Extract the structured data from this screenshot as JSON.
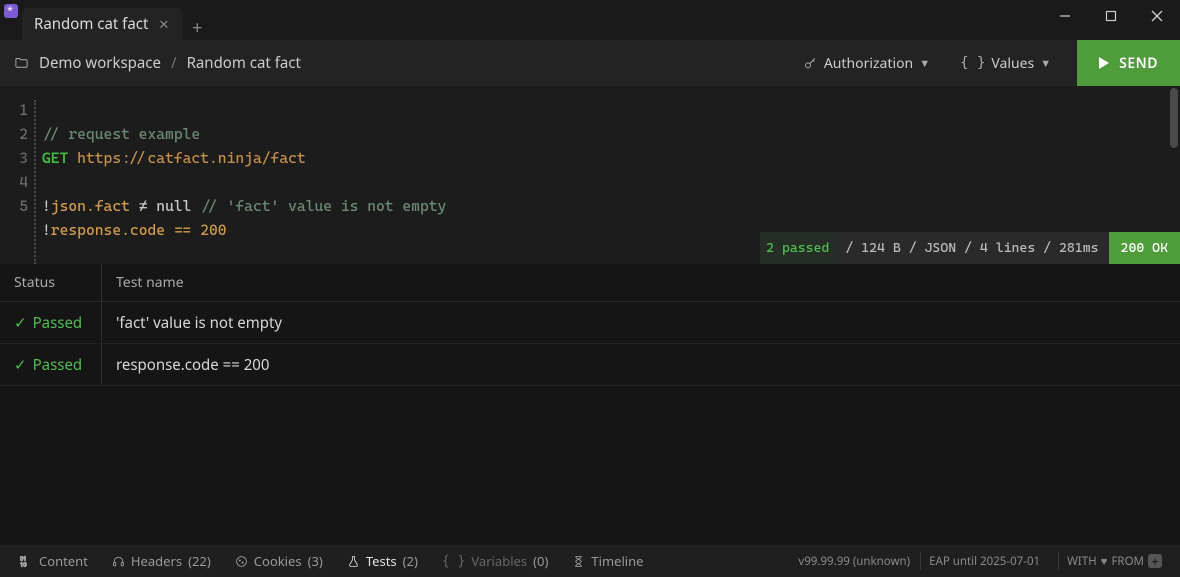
{
  "tab": {
    "title": "Random cat fact"
  },
  "breadcrumb": {
    "workspace": "Demo workspace",
    "item": "Random cat fact",
    "sep": "/"
  },
  "toolbar": {
    "authorization": "Authorization",
    "values": "Values",
    "send": "SEND"
  },
  "editor": {
    "lines": [
      "1",
      "2",
      "3",
      "4",
      "5"
    ],
    "l1_comment": "// request example",
    "l2_method": "GET",
    "l2_url": "https://catfact.ninja/fact",
    "l4_bang": "!",
    "l4_expr": "json.fact",
    "l4_op": " ≠ ",
    "l4_rhs": "null",
    "l4_comment": " // 'fact' value is not empty",
    "l5_bang": "!",
    "l5_expr": "response.code == 200"
  },
  "status": {
    "passed": "2 passed",
    "meta": " / 124 B / JSON / 4 lines / 281ms",
    "code": "200 OK"
  },
  "results": {
    "hdr_status": "Status",
    "hdr_name": "Test name",
    "rows": [
      {
        "status": "Passed",
        "name": "'fact' value is not empty"
      },
      {
        "status": "Passed",
        "name": "response.code == 200"
      }
    ]
  },
  "bottom": {
    "content": "Content",
    "headers": "Headers",
    "headers_count": "(22)",
    "cookies": "Cookies",
    "cookies_count": "(3)",
    "tests": "Tests",
    "tests_count": "(2)",
    "variables": "Variables",
    "variables_count": "(0)",
    "timeline": "Timeline",
    "version": "v99.99.99 (unknown)",
    "eap": "EAP until 2025-07-01",
    "with": "WITH",
    "from": "FROM"
  }
}
